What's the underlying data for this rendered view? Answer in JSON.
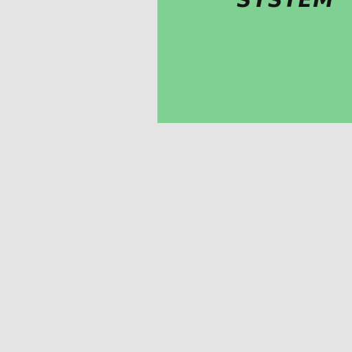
{
  "background_color": "#e4e4e4",
  "tile": {
    "title": "SYSTEM",
    "color": "#80cf93",
    "text_color": "#141414"
  }
}
